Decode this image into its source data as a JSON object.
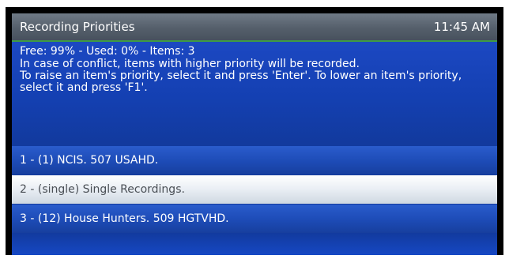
{
  "header": {
    "title": "Recording Priorities",
    "clock": "11:45 AM"
  },
  "info": {
    "stats": "Free: 99% - Used: 0% - Items: 3",
    "lines": [
      "In case of conflict, items with higher priority will  be recorded.",
      "To raise an item's priority, select it and press 'Enter'. To lower an item's priority,",
      "select it and press 'F1'."
    ]
  },
  "priority_list": {
    "selected_index": 1,
    "items": [
      "1 - (1) NCIS. 507 USAHD.",
      "2 - (single) Single Recordings.",
      "3 - (12) House Hunters. 509 HGTVHD."
    ]
  },
  "colors": {
    "panel_background": "#123a9e",
    "header_background": "#555f6b",
    "header_accent_line": "#3f9b45",
    "selected_row": "#e9eef4",
    "selected_text": "#4a4f55"
  }
}
